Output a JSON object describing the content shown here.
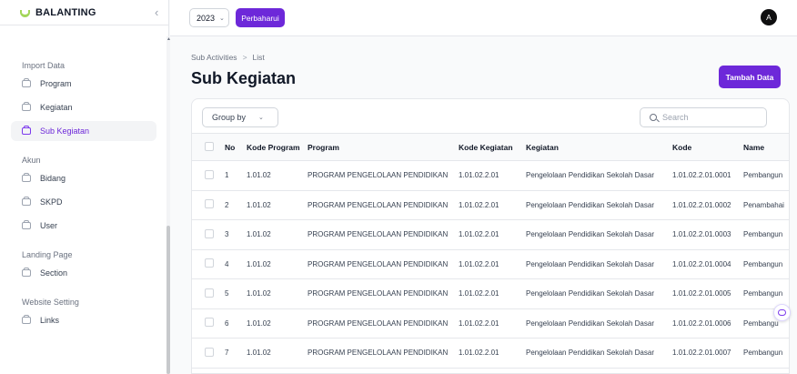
{
  "brand": {
    "name": "BALANTING",
    "collapse_icon": "chevron-left-icon"
  },
  "topbar": {
    "year": "2023",
    "update_label": "Perbaharui",
    "avatar_initial": "A"
  },
  "sidebar": {
    "groups": [
      {
        "label": "Import Data",
        "items": [
          {
            "label": "Program",
            "active": false
          },
          {
            "label": "Kegiatan",
            "active": false
          },
          {
            "label": "Sub Kegiatan",
            "active": true
          }
        ]
      },
      {
        "label": "Akun",
        "items": [
          {
            "label": "Bidang",
            "active": false
          },
          {
            "label": "SKPD",
            "active": false
          },
          {
            "label": "User",
            "active": false
          }
        ]
      },
      {
        "label": "Landing Page",
        "items": [
          {
            "label": "Section",
            "active": false
          }
        ]
      },
      {
        "label": "Website Setting",
        "items": [
          {
            "label": "Links",
            "active": false
          }
        ]
      }
    ]
  },
  "breadcrumb": {
    "parent": "Sub Activities",
    "separator": ">",
    "current": "List"
  },
  "page": {
    "title": "Sub Kegiatan",
    "add_label": "Tambah Data"
  },
  "toolbar": {
    "group_by_label": "Group by",
    "search_placeholder": "Search"
  },
  "table": {
    "headers": [
      "No",
      "Kode Program",
      "Program",
      "Kode Kegiatan",
      "Kegiatan",
      "Kode",
      "Name"
    ],
    "rows": [
      [
        "1",
        "1.01.02",
        "PROGRAM PENGELOLAAN PENDIDIKAN",
        "1.01.02.2.01",
        "Pengelolaan Pendidikan Sekolah Dasar",
        "1.01.02.2.01.0001",
        "Pembangun"
      ],
      [
        "2",
        "1.01.02",
        "PROGRAM PENGELOLAAN PENDIDIKAN",
        "1.01.02.2.01",
        "Pengelolaan Pendidikan Sekolah Dasar",
        "1.01.02.2.01.0002",
        "Penambahai"
      ],
      [
        "3",
        "1.01.02",
        "PROGRAM PENGELOLAAN PENDIDIKAN",
        "1.01.02.2.01",
        "Pengelolaan Pendidikan Sekolah Dasar",
        "1.01.02.2.01.0003",
        "Pembangun"
      ],
      [
        "4",
        "1.01.02",
        "PROGRAM PENGELOLAAN PENDIDIKAN",
        "1.01.02.2.01",
        "Pengelolaan Pendidikan Sekolah Dasar",
        "1.01.02.2.01.0004",
        "Pembangun"
      ],
      [
        "5",
        "1.01.02",
        "PROGRAM PENGELOLAAN PENDIDIKAN",
        "1.01.02.2.01",
        "Pengelolaan Pendidikan Sekolah Dasar",
        "1.01.02.2.01.0005",
        "Pembangun"
      ],
      [
        "6",
        "1.01.02",
        "PROGRAM PENGELOLAAN PENDIDIKAN",
        "1.01.02.2.01",
        "Pengelolaan Pendidikan Sekolah Dasar",
        "1.01.02.2.01.0006",
        "Pembangu"
      ],
      [
        "7",
        "1.01.02",
        "PROGRAM PENGELOLAAN PENDIDIKAN",
        "1.01.02.2.01",
        "Pengelolaan Pendidikan Sekolah Dasar",
        "1.01.02.2.01.0007",
        "Pembangun"
      ]
    ]
  },
  "colors": {
    "accent": "#6d28d9",
    "brand_mark": "#a3d65a"
  }
}
